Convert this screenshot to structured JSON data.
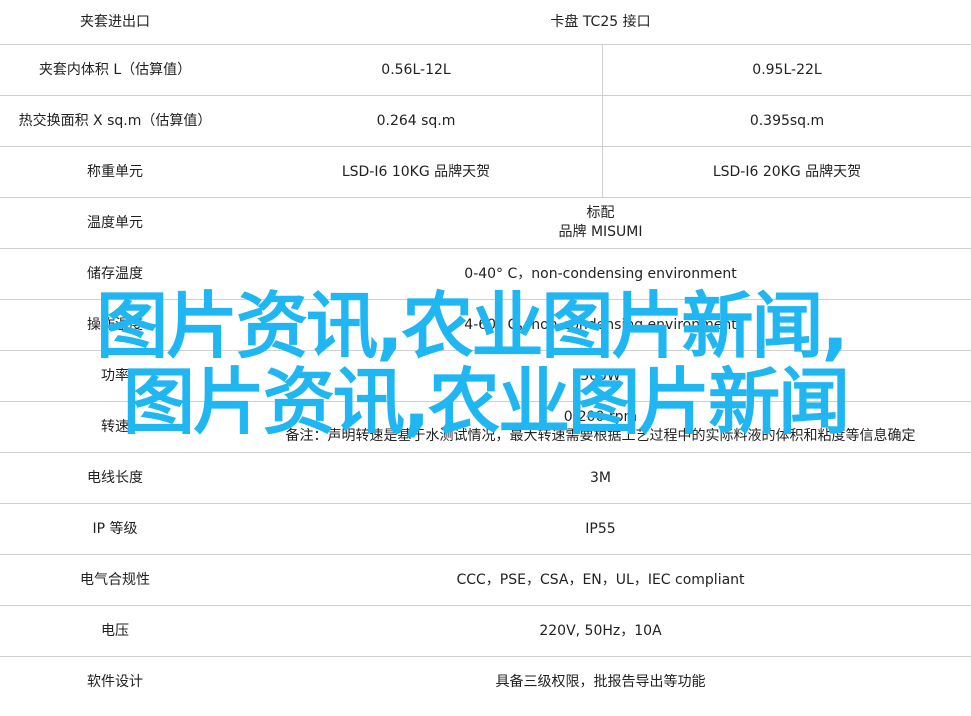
{
  "rows": [
    {
      "label": "夹套进出口",
      "value": "卡盘 TC25 接口"
    },
    {
      "label": "夹套内体积 L（估算值）",
      "value_a": "0.56L-12L",
      "value_b": "0.95L-22L"
    },
    {
      "label": "热交换面积 X sq.m（估算值）",
      "value_a": "0.264 sq.m",
      "value_b": "0.395sq.m"
    },
    {
      "label": "称重单元",
      "value_a": "LSD-I6 10KG 品牌天贺",
      "value_b": "LSD-I6 20KG 品牌天贺"
    },
    {
      "label": "温度单元",
      "value_line1": "标配",
      "value_line2": "品牌 MISUMI"
    },
    {
      "label": "储存温度",
      "value": "0-40° C，non-condensing environment"
    },
    {
      "label": "操作温度",
      "value": "4-60° C，non-condensing environment"
    },
    {
      "label": "功率",
      "value": "300W"
    },
    {
      "label": "转速",
      "value": "0-200 rpm"
    },
    {
      "label": "电线长度",
      "value": "3M"
    },
    {
      "label": "IP 等级",
      "value": "IP55"
    },
    {
      "label": "电气合规性",
      "value": "CCC，PSE，CSA，EN，UL，IEC compliant"
    },
    {
      "label": "电压",
      "value": "220V, 50Hz，10A"
    },
    {
      "label": "软件设计",
      "value": "具备三级权限，批报告导出等功能"
    }
  ],
  "note": "备注：声明转速是基于水测试情况，最大转速需要根据工艺过程中的实际料液的体积和粘度等信息确定",
  "overlay": {
    "line1": "图片资讯,农业图片新闻,",
    "line2": "图片资讯,农业图片新闻"
  }
}
